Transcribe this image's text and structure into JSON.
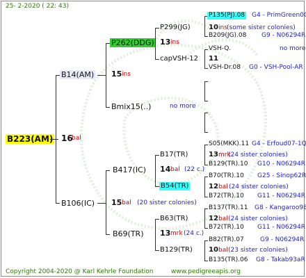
{
  "header": {
    "date": "25-  2-2020  ( 22: 43)"
  },
  "footer": {
    "copyright": "Copyright 2004-2020 @ Karl Kehrle Foundation",
    "url": "www.pedigreeapis.org"
  },
  "colors": {
    "root_bg": "#ffff00",
    "p_bg": "#33cc33",
    "cyan_bg": "#33ffff",
    "link_blue": "#2222cc",
    "num_red": "#cc0000",
    "green": "#2a7d00"
  },
  "root": {
    "name": "B223(AM)",
    "num": "16",
    "tag": "bal"
  },
  "g1": {
    "upper": {
      "name": "B14(AM)",
      "num": "15",
      "tag": "ins"
    },
    "lower": {
      "name": "B106(IC)",
      "num": "15",
      "tag": "bal",
      "note": "(20 sister colonies)"
    }
  },
  "g2": {
    "a": {
      "name": "P262(DDG)",
      "num": "13",
      "tag": "ins"
    },
    "b": {
      "name": "Bmix15(..)",
      "note": "no more"
    },
    "c": {
      "name": "B417(IC)",
      "num": "14",
      "tag": "bal",
      "note": "(22 c.)"
    },
    "d": {
      "name": "B69(TR)",
      "num": "13",
      "tag": "mrk",
      "note": "(24 c.)"
    }
  },
  "g3": {
    "a": {
      "name": "P299(JG)",
      "num": "10",
      "tag": "ins",
      "note": "(some sister colonies)"
    },
    "b": {
      "name": "capVSH-12",
      "num": "11"
    },
    "c": {
      "name": "B17(TR)",
      "num": "13",
      "tag": "mrk",
      "note": "(24 sister colonies)"
    },
    "d": {
      "name": "B54(TR)",
      "num": "12",
      "tag": "bal",
      "note": "(24 sister colonies)"
    },
    "e": {
      "name": "B63(TR)",
      "num": "12",
      "tag": "bal",
      "note": "(24 sister colonies)"
    },
    "f": {
      "name": "B129(TR)",
      "num": "10",
      "tag": "bal",
      "note": "(23 sister colonies)"
    }
  },
  "g4": [
    {
      "name": "P135(PJ).08",
      "extra": "G4 - PrimGreen00"
    },
    {
      "name": "B209(JG).08",
      "extra": "G9 - N06294R"
    },
    {
      "name": "VSH-Q.",
      "extra": "no more"
    },
    {
      "name": "VSH-Dr.08",
      "extra": "G0 - VSH-Pool-AR"
    },
    {
      "name": "S05(MKK).11",
      "extra": "G4 - Erfoud07-1Q"
    },
    {
      "name": "B129(TR).10",
      "extra": "G10 - N06294R"
    },
    {
      "name": "B70(TR).10",
      "extra": "G25 - Sinop62R"
    },
    {
      "name": "B72(TR).10",
      "extra": "G11 - N06294R"
    },
    {
      "name": "B137(TR).11",
      "extra": "G8 - Kangaroo98R"
    },
    {
      "name": "B72(TR).10",
      "extra": "G11 - N06294R"
    },
    {
      "name": "B82(TR).07",
      "extra": "G9 - N06294R"
    },
    {
      "name": "B135(TR).06",
      "extra": "G8 - Takab93aR"
    }
  ]
}
